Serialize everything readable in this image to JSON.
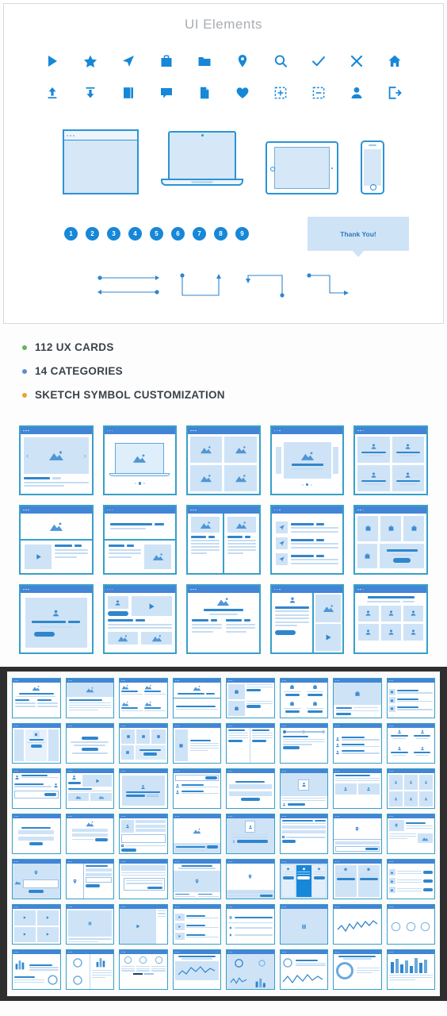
{
  "panel": {
    "title": "UI Elements",
    "icons_row1": [
      {
        "name": "play-icon"
      },
      {
        "name": "star-icon"
      },
      {
        "name": "navigation-arrow-icon"
      },
      {
        "name": "briefcase-icon"
      },
      {
        "name": "folder-icon"
      },
      {
        "name": "map-pin-icon"
      },
      {
        "name": "search-icon"
      },
      {
        "name": "check-icon"
      },
      {
        "name": "close-icon"
      },
      {
        "name": "home-icon"
      }
    ],
    "icons_row2": [
      {
        "name": "upload-icon"
      },
      {
        "name": "download-icon"
      },
      {
        "name": "book-icon"
      },
      {
        "name": "chat-bubble-icon"
      },
      {
        "name": "document-icon"
      },
      {
        "name": "heart-icon"
      },
      {
        "name": "add-selection-icon"
      },
      {
        "name": "remove-selection-icon"
      },
      {
        "name": "user-icon"
      },
      {
        "name": "logout-icon"
      }
    ],
    "devices": [
      {
        "name": "browser-window-mockup"
      },
      {
        "name": "laptop-mockup"
      },
      {
        "name": "tablet-mockup"
      },
      {
        "name": "phone-mockup"
      }
    ],
    "pagination": [
      "1",
      "2",
      "3",
      "4",
      "5",
      "6",
      "7",
      "8",
      "9"
    ],
    "tooltip_text": "Thank You!",
    "connectors": [
      {
        "name": "double-horizontal-arrow-connector"
      },
      {
        "name": "u-shape-connector"
      },
      {
        "name": "step-up-connector"
      },
      {
        "name": "z-step-connector"
      }
    ]
  },
  "features": [
    {
      "label": "112 UX CARDS",
      "bullet_color": "#5cb85c"
    },
    {
      "label": "14 CATEGORIES",
      "bullet_color": "#5b8fd0"
    },
    {
      "label": "SKETCH SYMBOL CUSTOMIZATION",
      "bullet_color": "#e8a33d"
    }
  ],
  "card_grid": {
    "columns": 5,
    "rows": 3,
    "cards": [
      {
        "name": "card-image-carousel"
      },
      {
        "name": "card-laptop-hero"
      },
      {
        "name": "card-image-quad-grid"
      },
      {
        "name": "card-centered-hero-slider"
      },
      {
        "name": "card-team-quad-profiles"
      },
      {
        "name": "card-hero-image-video-list"
      },
      {
        "name": "card-search-text-image"
      },
      {
        "name": "card-two-column-article"
      },
      {
        "name": "card-icon-feed-list"
      },
      {
        "name": "card-product-icon-grid"
      },
      {
        "name": "card-login-form"
      },
      {
        "name": "card-profile-video-gallery"
      },
      {
        "name": "card-article-image-columns"
      },
      {
        "name": "card-profile-sidebar-media"
      },
      {
        "name": "card-team-six-profiles"
      }
    ]
  },
  "dense_grid": {
    "columns": 8,
    "rows": 7,
    "cards": [
      {
        "name": "mini-card-hero-two-col"
      },
      {
        "name": "mini-card-image-header-text"
      },
      {
        "name": "mini-card-image-quad"
      },
      {
        "name": "mini-card-hero-divider"
      },
      {
        "name": "mini-card-list-two-rows"
      },
      {
        "name": "mini-card-icon-quad-buttons"
      },
      {
        "name": "mini-card-icon-center-text"
      },
      {
        "name": "mini-card-icon-list-rows"
      },
      {
        "name": "mini-card-three-col-feature"
      },
      {
        "name": "mini-card-centered-form"
      },
      {
        "name": "mini-card-icon-three-grid"
      },
      {
        "name": "mini-card-sidebar-text"
      },
      {
        "name": "mini-card-two-col-list"
      },
      {
        "name": "mini-card-stepper-timeline"
      },
      {
        "name": "mini-card-profile-rows"
      },
      {
        "name": "mini-card-profile-quad"
      },
      {
        "name": "mini-card-profile-comment"
      },
      {
        "name": "mini-card-profile-video-thumbs"
      },
      {
        "name": "mini-card-centered-profile"
      },
      {
        "name": "mini-card-search-profiles"
      },
      {
        "name": "mini-card-form-stack"
      },
      {
        "name": "mini-card-profile-banner"
      },
      {
        "name": "mini-card-profile-grid-two"
      },
      {
        "name": "mini-card-profile-six-grid"
      },
      {
        "name": "mini-card-form-center-button"
      },
      {
        "name": "mini-card-image-text-button"
      },
      {
        "name": "mini-card-icon-sidebar-form"
      },
      {
        "name": "mini-card-image-search-bar"
      },
      {
        "name": "mini-card-profile-card-center"
      },
      {
        "name": "mini-card-text-blocks"
      },
      {
        "name": "mini-card-map-pin-form"
      },
      {
        "name": "mini-card-map-pin-image"
      },
      {
        "name": "mini-card-map-pin-gallery"
      },
      {
        "name": "mini-card-pin-sidebar-form"
      },
      {
        "name": "mini-card-modal-overlay"
      },
      {
        "name": "mini-card-map-pin-hero"
      },
      {
        "name": "mini-card-pin-search-result"
      },
      {
        "name": "mini-card-pricing-featured"
      },
      {
        "name": "mini-card-pricing-two-col"
      },
      {
        "name": "mini-card-star-rating-list"
      },
      {
        "name": "mini-card-video-two-up"
      },
      {
        "name": "mini-card-player-pause"
      },
      {
        "name": "mini-card-player-center"
      },
      {
        "name": "mini-card-playlist-rows"
      },
      {
        "name": "mini-card-audio-progress"
      },
      {
        "name": "mini-card-player-large"
      },
      {
        "name": "mini-card-waveform-graph"
      },
      {
        "name": "mini-card-three-circles"
      },
      {
        "name": "mini-card-bar-chart-donut"
      },
      {
        "name": "mini-card-donuts-bars"
      },
      {
        "name": "mini-card-three-donuts-table"
      },
      {
        "name": "mini-card-line-chart-panel"
      },
      {
        "name": "mini-card-mixed-analytics"
      },
      {
        "name": "mini-card-donut-line-stats"
      },
      {
        "name": "mini-card-big-donut-stats"
      },
      {
        "name": "mini-card-bar-chart-dashboard"
      }
    ]
  },
  "colors": {
    "icon_blue": "#1787d8",
    "card_border": "#37a0c9",
    "card_titlebar": "#4285d6",
    "placeholder_blue": "#cfe3f7",
    "line_blue": "#9dc4e8",
    "accent_dark_blue": "#2f86cd",
    "frame_dark": "#2f2f2f",
    "title_gray": "#a9adb2",
    "text_dark": "#3b4249"
  }
}
